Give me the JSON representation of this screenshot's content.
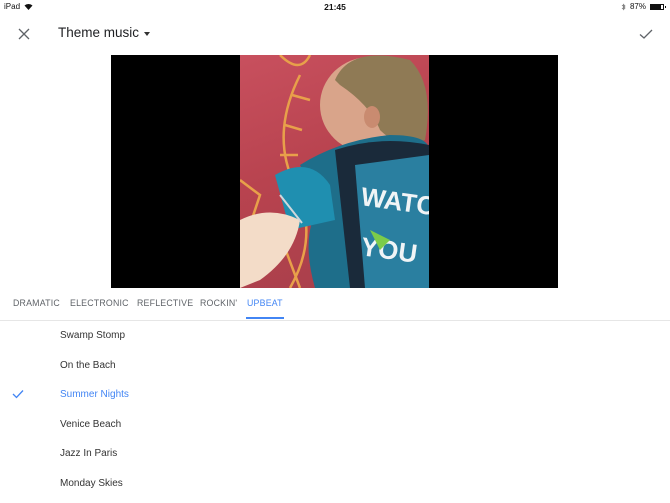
{
  "status_bar": {
    "device": "iPad",
    "time": "21:45",
    "battery_percent": "87%",
    "battery_level": 0.87
  },
  "toolbar": {
    "title": "Theme music",
    "close_icon": "close-icon",
    "confirm_icon": "check-icon"
  },
  "tabs": [
    {
      "label": "DRAMATIC",
      "active": false
    },
    {
      "label": "ELECTRONIC",
      "active": false
    },
    {
      "label": "REFLECTIVE",
      "active": false
    },
    {
      "label": "ROCKIN'",
      "active": false
    },
    {
      "label": "UPBEAT",
      "active": true
    }
  ],
  "tracks": [
    {
      "label": "Swamp Stomp",
      "selected": false
    },
    {
      "label": "On the Bach",
      "selected": false
    },
    {
      "label": "Summer Nights",
      "selected": true
    },
    {
      "label": "Venice Beach",
      "selected": false
    },
    {
      "label": "Jazz In Paris",
      "selected": false
    },
    {
      "label": "Monday Skies",
      "selected": false
    }
  ],
  "colors": {
    "accent": "#4285f4"
  }
}
